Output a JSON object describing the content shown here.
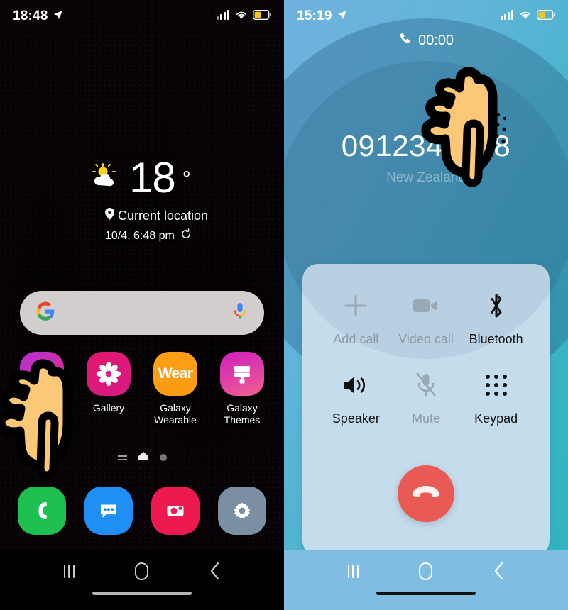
{
  "left_phone": {
    "status_bar": {
      "time": "18:48",
      "location_icon": "location-arrow-icon",
      "signal_icon": "cellular-signal-icon",
      "wifi_icon": "wifi-icon",
      "battery_icon": "battery-icon",
      "battery_color": "#f5c518"
    },
    "weather_widget": {
      "icon": "sun-behind-cloud-icon",
      "temperature": "18",
      "degree": "°",
      "location_pin_icon": "map-pin-icon",
      "location": "Current location",
      "updated": "10/4, 6:48 pm",
      "refresh_icon": "refresh-icon"
    },
    "search_bar": {
      "google_icon": "google-g-icon",
      "mic_icon": "microphone-icon",
      "placeholder": ""
    },
    "apps": [
      {
        "label": "",
        "name": "galaxy-store",
        "icon": "shopping-bag-icon",
        "color": "#e8287f",
        "color2": "#b233d6"
      },
      {
        "label": "Gallery",
        "name": "gallery",
        "icon": "flower-icon",
        "color": "#e5176d",
        "color2": "#d61a86"
      },
      {
        "label": "Galaxy Wearable",
        "name": "galaxy-wearable",
        "icon": "wear-text-icon",
        "color": "#fb9b12",
        "color2": "#fba016",
        "text": "Wear"
      },
      {
        "label": "Galaxy Themes",
        "name": "galaxy-themes",
        "icon": "paint-roller-icon",
        "color": "#cf1ec1",
        "color2": "#f0608f"
      }
    ],
    "page_indicator": {
      "lines_icon": "menu-lines-icon",
      "home_icon": "home-page-icon",
      "dot_icon": "page-dot-icon"
    },
    "dock": [
      {
        "label": "",
        "name": "phone",
        "icon": "phone-handset-icon",
        "color": "#1ec04f"
      },
      {
        "label": "",
        "name": "messages",
        "icon": "chat-bubble-icon",
        "color": "#1f8ff5"
      },
      {
        "label": "",
        "name": "camera",
        "icon": "camera-icon",
        "color": "#ec1a50"
      },
      {
        "label": "",
        "name": "settings",
        "icon": "gear-icon",
        "color": "#7a8fa1"
      }
    ],
    "nav_bar": {
      "recents": "recents-icon",
      "home": "home-icon",
      "back": "back-icon",
      "tint": "#ffffff"
    },
    "cursor": {
      "type": "pointing-hand-cursor"
    }
  },
  "right_phone": {
    "status_bar": {
      "time": "15:19",
      "location_icon": "location-arrow-icon",
      "signal_icon": "cellular-signal-icon",
      "wifi_icon": "wifi-icon",
      "battery_icon": "battery-icon",
      "battery_color": "#f5c518"
    },
    "call": {
      "timer_icon": "phone-handset-icon",
      "timer": "00:00",
      "number": "0912345678",
      "country": "New Zealand"
    },
    "controls": [
      {
        "label": "Add call",
        "name": "add-call",
        "icon": "plus-icon",
        "enabled": false
      },
      {
        "label": "Video call",
        "name": "video-call",
        "icon": "video-camera-icon",
        "enabled": false
      },
      {
        "label": "Bluetooth",
        "name": "bluetooth",
        "icon": "bluetooth-icon",
        "enabled": true
      },
      {
        "label": "Speaker",
        "name": "speaker",
        "icon": "speaker-icon",
        "enabled": true
      },
      {
        "label": "Mute",
        "name": "mute",
        "icon": "mic-off-icon",
        "enabled": false
      },
      {
        "label": "Keypad",
        "name": "keypad",
        "icon": "keypad-icon",
        "enabled": true
      }
    ],
    "end_call": {
      "label": "",
      "icon": "end-call-icon",
      "color": "#ea5a54"
    },
    "nav_bar": {
      "recents": "recents-icon",
      "home": "home-icon",
      "back": "back-icon",
      "tint": "#ffffff"
    },
    "cursor": {
      "type": "pointing-hand-cursor",
      "tap_dots": "tap-indicator-dots"
    },
    "theme": {
      "accent": "#3bb3c4",
      "card": "#c5dcec",
      "ring": "#2e678c"
    }
  }
}
